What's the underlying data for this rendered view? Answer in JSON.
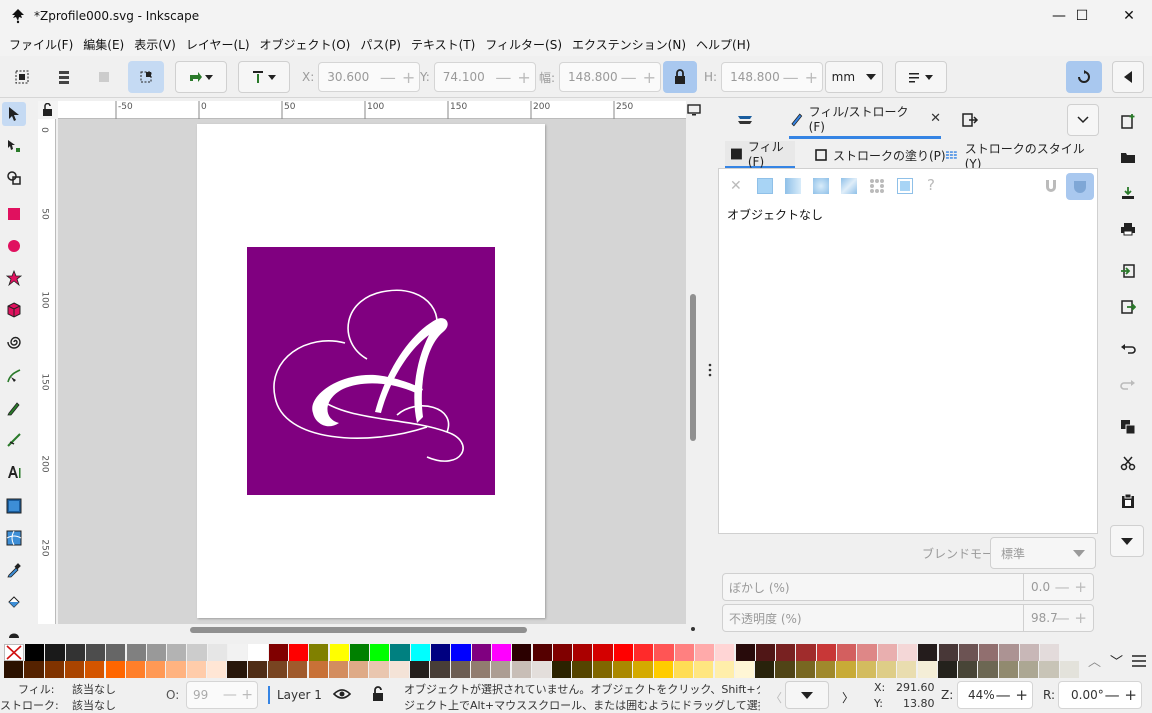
{
  "window": {
    "title": "*Zprofile000.svg - Inkscape",
    "minimize": "—",
    "maximize": "☐",
    "close": "✕"
  },
  "menu": [
    "ファイル(F)",
    "編集(E)",
    "表示(V)",
    "レイヤー(L)",
    "オブジェクト(O)",
    "パス(P)",
    "テキスト(T)",
    "フィルター(S)",
    "エクステンション(N)",
    "ヘルプ(H)"
  ],
  "toolbar": {
    "x_label": "X:",
    "x_value": "30.600",
    "y_label": "Y:",
    "y_value": "74.100",
    "w_label": "幅:",
    "w_value": "148.800",
    "h_label": "H:",
    "h_value": "148.800",
    "unit": "mm"
  },
  "rulers": {
    "h_ticks": [
      "-50",
      "0",
      "50",
      "100",
      "150",
      "200",
      "250"
    ],
    "v_ticks": [
      "0",
      "50",
      "100",
      "150",
      "200",
      "250"
    ]
  },
  "dock": {
    "active_tab": "フィル/ストローク(F)",
    "subtabs": [
      "フィル(F)",
      "ストロークの塗り(P)",
      "ストロークのスタイル(Y)"
    ],
    "no_object": "オブジェクトなし",
    "unknown_paint": "?",
    "blend_label": "ブレンドモード:",
    "blend_value": "標準",
    "blur_label": "ぼかし (%)",
    "blur_value": "0.0",
    "opacity_label": "不透明度 (%)",
    "opacity_value": "98.7"
  },
  "document": {
    "background_color": "#800080",
    "letter_color": "#ffffff"
  },
  "status": {
    "fill_label": "フィル:",
    "fill_value": "該当なし",
    "stroke_label": "ストローク:",
    "stroke_value": "該当なし",
    "opacity_label": "O:",
    "opacity_value": "99",
    "layer": "Layer 1",
    "message_line1": "オブジェクトが選択されていません。オブジェクトをクリック、Shift+クリック、オブ",
    "message_line2": "ジェクト上でAlt+マウススクロール、または囲むようにドラッグして選択してくだ...",
    "x_label": "X:",
    "x_value": "291.60",
    "y_label": "Y:",
    "y_value": "13.80",
    "zoom_label": "Z:",
    "zoom_value": "44%",
    "rotate_label": "R:",
    "rotate_value": "0.00°"
  },
  "palette_row1": [
    "#000000",
    "#1a1a1a",
    "#333333",
    "#4d4d4d",
    "#666666",
    "#808080",
    "#999999",
    "#b3b3b3",
    "#cccccc",
    "#e6e6e6",
    "#f2f2f2",
    "#ffffff",
    "#800000",
    "#ff0000",
    "#808000",
    "#ffff00",
    "#008000",
    "#00ff00",
    "#008080",
    "#00ffff",
    "#000080",
    "#0000ff",
    "#800080",
    "#ff00ff",
    "#2b0000",
    "#550000",
    "#800000",
    "#aa0000",
    "#d40000",
    "#ff0000",
    "#ff2a2a",
    "#ff5555",
    "#ff8080",
    "#ffaaaa",
    "#ffd5d5",
    "#280b0b",
    "#501616",
    "#782121",
    "#a02c2c",
    "#c83737",
    "#d35f5f",
    "#de8787",
    "#e9afaf",
    "#f4d7d7",
    "#241c1c",
    "#483737",
    "#6c5353",
    "#916f6f",
    "#ac9393",
    "#c8b7b7",
    "#e3dbdb"
  ],
  "palette_row2": [
    "#2b1100",
    "#552200",
    "#803300",
    "#aa4400",
    "#d45500",
    "#ff6600",
    "#ff7f2a",
    "#ff9955",
    "#ffb380",
    "#ffccaa",
    "#ffe6d5",
    "#28170b",
    "#502d16",
    "#784421",
    "#a05a2c",
    "#c87137",
    "#d38d5f",
    "#deaa87",
    "#e9c6af",
    "#f4e3d7",
    "#241f1c",
    "#483e37",
    "#6c5d53",
    "#917c6f",
    "#ac9d93",
    "#c8beb7",
    "#e3dedb",
    "#2b2200",
    "#554400",
    "#806600",
    "#aa8800",
    "#d4aa00",
    "#ffcc00",
    "#ffdd55",
    "#ffe680",
    "#ffeeaa",
    "#fff6d5",
    "#28220b",
    "#504416",
    "#786721",
    "#a0892c",
    "#c8ab37",
    "#d3bc5f",
    "#decd87",
    "#e9ddaf",
    "#f4eed7",
    "#24221c",
    "#484537",
    "#6c6753",
    "#918a6f",
    "#aca793",
    "#c8c4b7",
    "#e3e2db"
  ]
}
